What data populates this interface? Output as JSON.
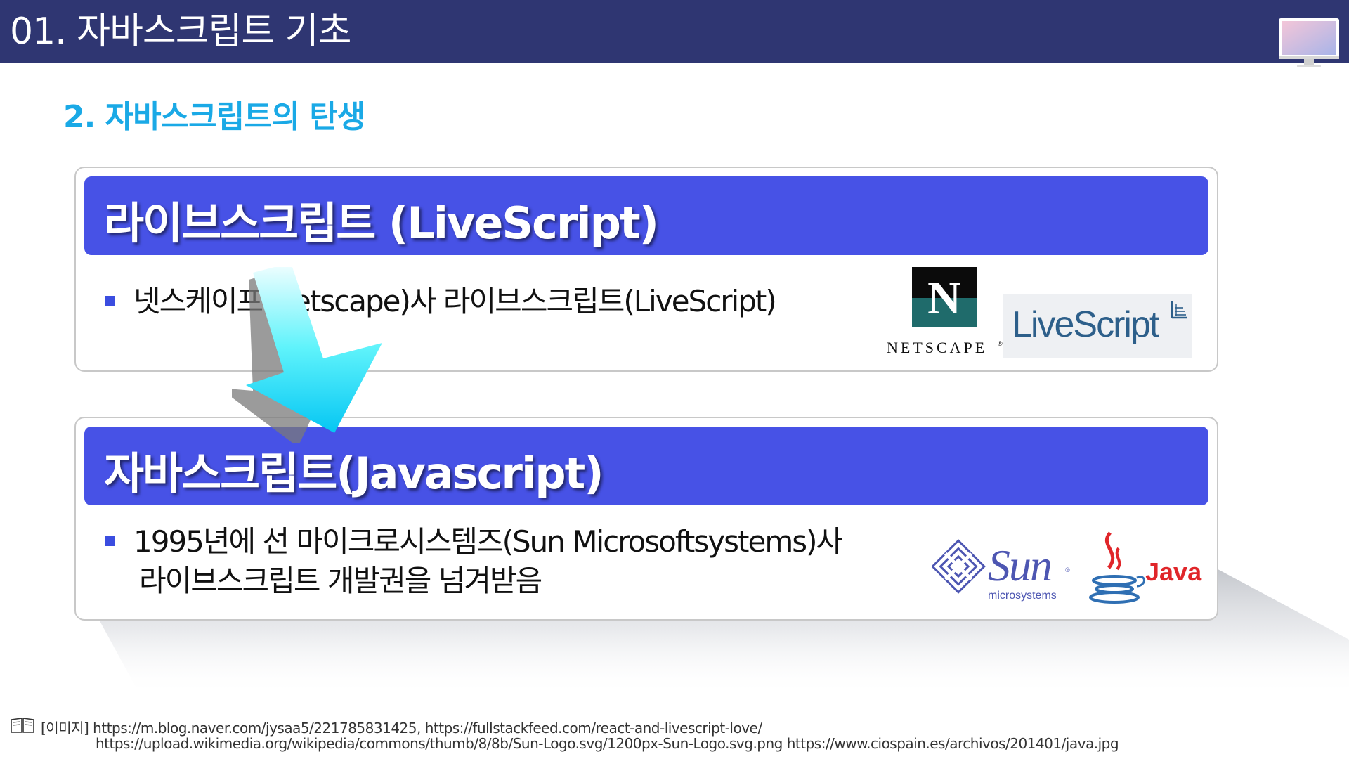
{
  "header": {
    "title": "01. 자바스크립트 기초",
    "background_color": "#2f3672",
    "monitor_icon": "monitor-icon"
  },
  "section": {
    "heading": "2. 자바스크립트의 탄생",
    "color": "#1aa9e6"
  },
  "cards": [
    {
      "title": "라이브스크립트 (LiveScript)",
      "bullets": [
        "넷스케이프(Netscape)사 라이브스크립트(LiveScript)"
      ],
      "logos": [
        {
          "name": "netscape-logo",
          "letter": "N",
          "text": "NETSCAPE",
          "mark": "®"
        },
        {
          "name": "livescript-logo",
          "text": "LiveScript"
        }
      ]
    },
    {
      "title": "자바스크립트(Javascript)",
      "bullets": [
        "1995년에 선 마이크로시스템즈(Sun Microsoftsystems)사",
        "라이브스크립트 개발권을 넘겨받음"
      ],
      "logos": [
        {
          "name": "sun-logo",
          "text": "Sun",
          "subtext": "microsystems",
          "mark": "®"
        },
        {
          "name": "java-logo",
          "text": "Java"
        }
      ]
    }
  ],
  "accent_color": "#4752e6",
  "transition_arrow": "down-arrow-icon",
  "credits": {
    "icon": "book-icon",
    "label": "[이미지]",
    "line1": "https://m.blog.naver.com/jysaa5/221785831425, https://fullstackfeed.com/react-and-livescript-love/",
    "line2": "https://upload.wikimedia.org/wikipedia/commons/thumb/8/8b/Sun-Logo.svg/1200px-Sun-Logo.svg.png https://www.ciospain.es/archivos/201401/java.jpg"
  }
}
